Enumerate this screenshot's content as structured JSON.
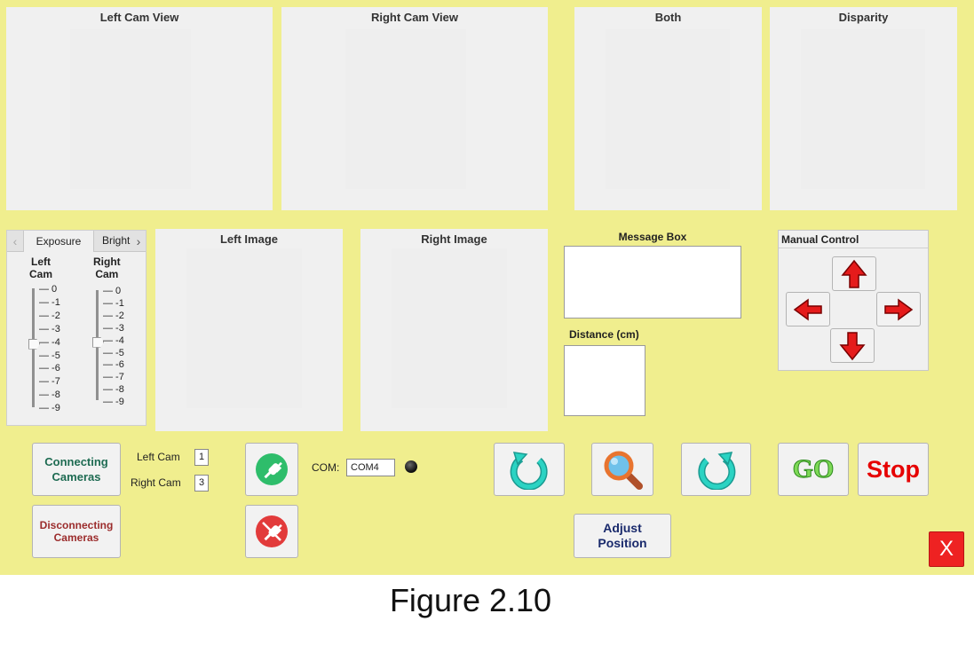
{
  "views": {
    "left_cam": "Left Cam View",
    "right_cam": "Right Cam View",
    "both": "Both",
    "disparity": "Disparity",
    "left_image": "Left Image",
    "right_image": "Right Image"
  },
  "tabs": {
    "exposure": "Exposure",
    "brightness": "Bright"
  },
  "sliders": {
    "left_label": "Left\nCam",
    "right_label": "Right\nCam",
    "ticks": [
      "0",
      "-1",
      "-2",
      "-3",
      "-4",
      "-5",
      "-6",
      "-7",
      "-8",
      "-9"
    ],
    "left_value": -4,
    "right_value": -4
  },
  "message_box": {
    "title": "Message Box",
    "distance_label": "Distance (cm)"
  },
  "manual_control": {
    "title": "Manual Control"
  },
  "cameras": {
    "connect_label": "Connecting\nCameras",
    "disconnect_label": "Disconnecting\nCameras",
    "left_label": "Left Cam",
    "left_value": "1",
    "right_label": "Right Cam",
    "right_value": "3"
  },
  "com": {
    "label": "COM:",
    "value": "COM4"
  },
  "actions": {
    "go": "GO",
    "stop": "Stop",
    "adjust": "Adjust\nPosition",
    "close": "X"
  },
  "caption": "Figure 2.10",
  "colors": {
    "background": "#f0ee8e",
    "connect_text": "#1e6b52",
    "disconnect_text": "#9b2c2c",
    "adjust_text": "#1a2a6c",
    "stop_text": "#e60000",
    "arrow_red": "#e51b1b",
    "plug_green": "#2ebd6b",
    "plug_red": "#e23b3b",
    "rotate_teal": "#2bd3c3",
    "close_red": "#ee2222"
  }
}
